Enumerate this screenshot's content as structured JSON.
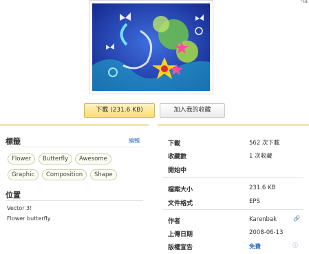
{
  "corner_mark": "Ча",
  "preview": {
    "image_alt": "Flower butterfly vector"
  },
  "buttons": {
    "download": "下載 (231.6 KB)",
    "collect": "加入我的收藏"
  },
  "tags_section": {
    "title": "標籤",
    "edit": "編輯",
    "tags": [
      "Flower",
      "Butterfly",
      "Awesome",
      "Graphic",
      "Composition",
      "Shape"
    ]
  },
  "location_section": {
    "title": "位置",
    "lines": [
      "Vector 3!",
      "Flower butterfly"
    ]
  },
  "info": {
    "rows": [
      {
        "label": "下載",
        "value": "562 次下載"
      },
      {
        "label": "收藏數",
        "value": "1 次收藏"
      },
      {
        "label": "開始中",
        "value": ""
      },
      {
        "label": "檔案大小",
        "value": "231.6 KB"
      },
      {
        "label": "文件格式",
        "value": "EPS"
      },
      {
        "label": "作者",
        "value": "Karenbak"
      },
      {
        "label": "上傳日期",
        "value": "2008-06-13"
      },
      {
        "label": "版權宣告",
        "value": "免費"
      }
    ]
  },
  "colors": {
    "accent": "#2f6fc4",
    "panel_border": "#f3e5b3",
    "download_btn": "#f6dc79"
  }
}
